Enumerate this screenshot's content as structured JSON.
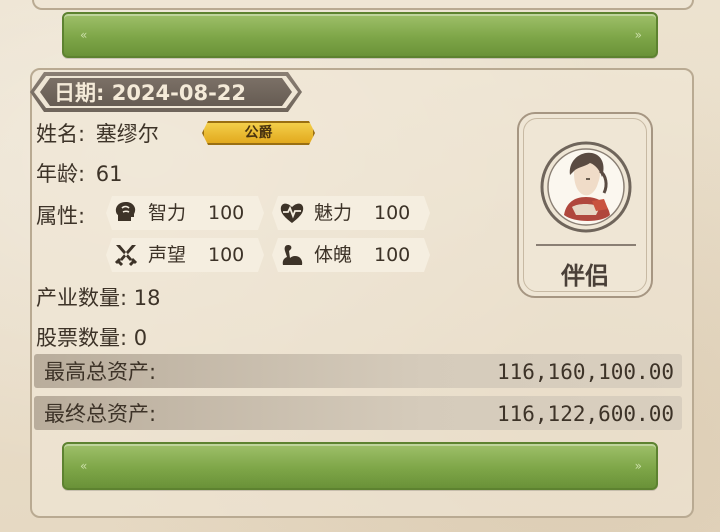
{
  "date": {
    "text": "日期: 2024-08-22"
  },
  "profile": {
    "name_label": "姓名:",
    "name_value": "塞缪尔",
    "title_badge": "公爵",
    "age_label": "年龄:",
    "age_value": "61",
    "attributes_label": "属性:",
    "attributes": [
      {
        "name": "智力",
        "value": "100",
        "icon": "brain-icon"
      },
      {
        "name": "魅力",
        "value": "100",
        "icon": "heart-pulse-icon"
      },
      {
        "name": "声望",
        "value": "100",
        "icon": "crossed-swords-icon"
      },
      {
        "name": "体魄",
        "value": "100",
        "icon": "flexed-arm-icon"
      }
    ],
    "property_label": "产业数量:",
    "property_value": "18",
    "stock_label": "股票数量:",
    "stock_value": "0"
  },
  "assets": {
    "max_label": "最高总资产:",
    "max_value": "116,160,100.00",
    "final_label": "最终总资产:",
    "final_value": "116,122,600.00"
  },
  "partner": {
    "label": "伴侣"
  },
  "colors": {
    "accent_green": "#7ea648",
    "badge_gold": "#e2a91e",
    "tab_gray": "#6f655b"
  }
}
